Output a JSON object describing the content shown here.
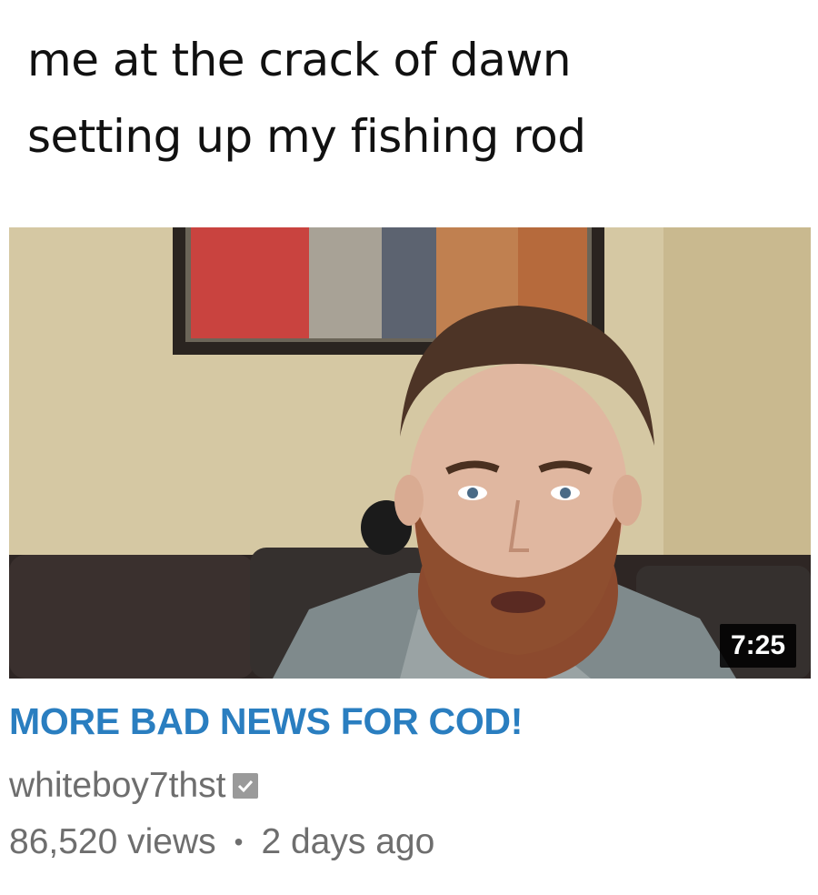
{
  "caption": {
    "line1": "me at the crack of dawn",
    "line2": "setting up my fishing rod"
  },
  "video": {
    "thumbnail_icon": "video-thumbnail-man-with-beard",
    "duration": "7:25",
    "title": "MORE BAD NEWS FOR COD!",
    "channel": "whiteboy7thst",
    "verified_icon": "verified-check-icon",
    "views": "86,520 views",
    "separator": "•",
    "age": "2 days ago"
  },
  "colors": {
    "title": "#2a7ec0",
    "meta": "#6e6e6e",
    "caption": "#111111"
  }
}
